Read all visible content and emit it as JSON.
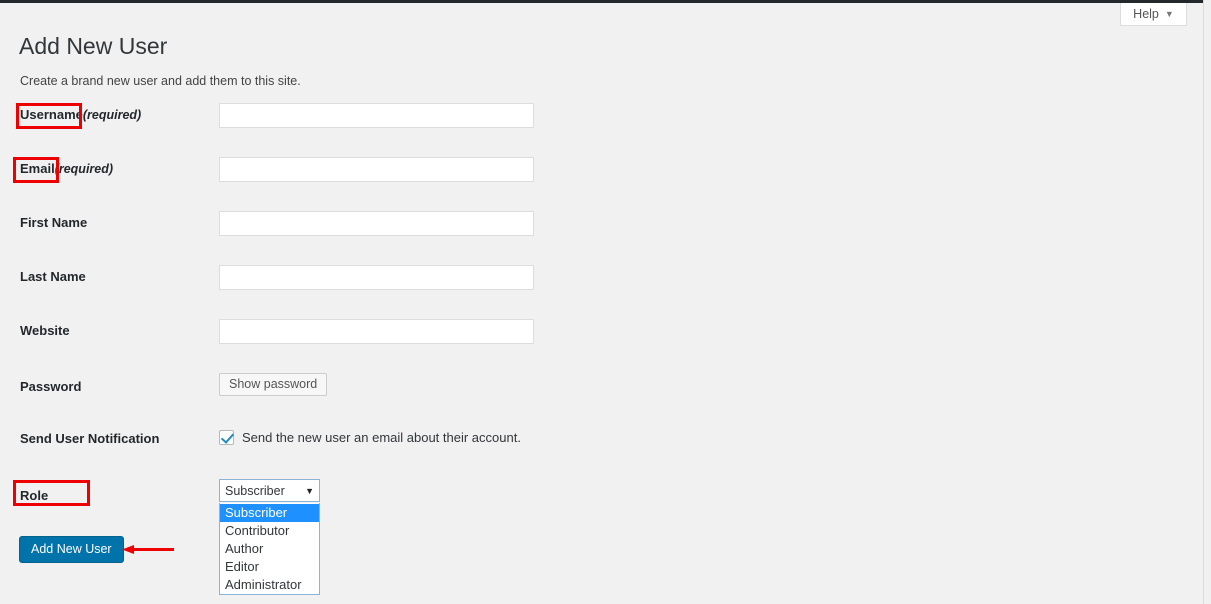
{
  "header": {
    "title": "Add New User",
    "subtitle": "Create a brand new user and add them to this site.",
    "help_label": "Help",
    "help_caret": "▼"
  },
  "form": {
    "fields": [
      {
        "label": "Username",
        "required_note": "(required)",
        "value": "",
        "placeholder": ""
      },
      {
        "label": "Email",
        "required_note": "(required)",
        "value": "",
        "placeholder": ""
      },
      {
        "label": "First Name",
        "required_note": "",
        "value": "",
        "placeholder": ""
      },
      {
        "label": "Last Name",
        "required_note": "",
        "value": "",
        "placeholder": ""
      },
      {
        "label": "Website",
        "required_note": "",
        "value": "",
        "placeholder": ""
      }
    ],
    "password": {
      "label": "Password",
      "show_password_label": "Show password"
    },
    "notification": {
      "label": "Send User Notification",
      "checkbox_text": "Send the new user an email about their account.",
      "checked": true
    },
    "role": {
      "label": "Role",
      "selected": "Subscriber",
      "caret": "▼",
      "options": [
        "Subscriber",
        "Contributor",
        "Author",
        "Editor",
        "Administrator"
      ]
    },
    "submit_label": "Add New User"
  },
  "annotations": {
    "color": "#ee0000",
    "boxes": [
      {
        "target": "username-label"
      },
      {
        "target": "email-label"
      },
      {
        "target": "role-label"
      }
    ],
    "arrow": {
      "target": "add-new-user-button",
      "direction": "left"
    }
  },
  "colors": {
    "page_background": "#f1f1f1",
    "admin_bar": "#23282d",
    "primary_button": "#0073aa",
    "option_highlight": "#1e90ff",
    "annotation_red": "#ee0000"
  }
}
